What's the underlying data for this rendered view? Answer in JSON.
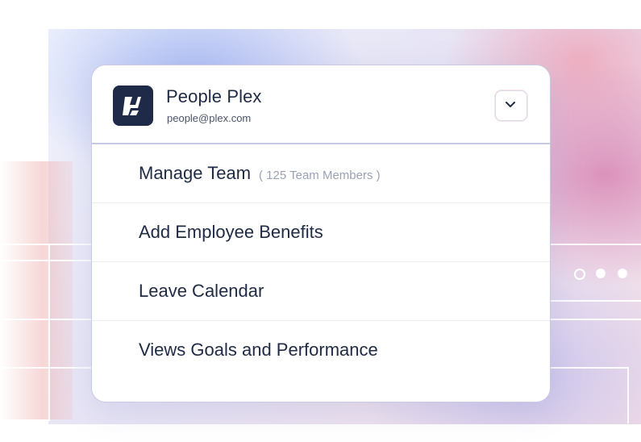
{
  "org": {
    "name": "People Plex",
    "email": "people@plex.com"
  },
  "menu": {
    "items": [
      {
        "label": "Manage Team",
        "sub": "( 125 Team Members )"
      },
      {
        "label": "Add Employee Benefits"
      },
      {
        "label": "Leave Calendar"
      },
      {
        "label": "Views Goals and Performance"
      }
    ]
  },
  "colors": {
    "logo_bg": "#1e2a48",
    "text_primary": "#1f2a44",
    "text_muted": "#9aa1b3"
  },
  "icons": {
    "logo": "people-plex-logo",
    "dropdown": "chevron-down-icon"
  }
}
